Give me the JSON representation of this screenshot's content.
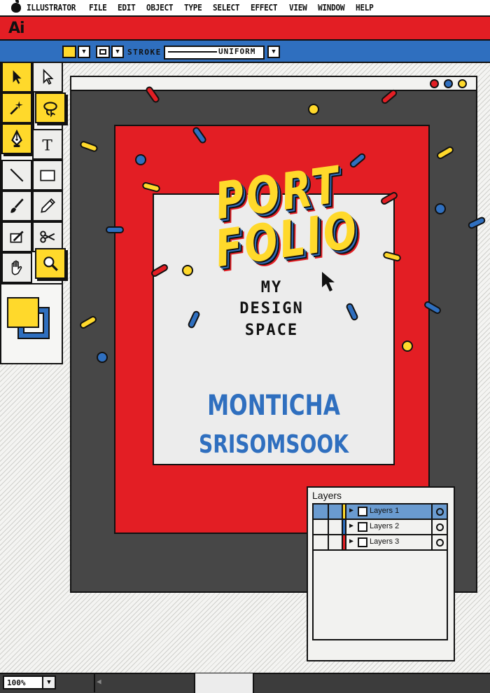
{
  "menu": {
    "apple_icon": "apple-icon",
    "items": [
      "ILLUSTRATOR",
      "FILE",
      "EDIT",
      "OBJECT",
      "TYPE",
      "SELECT",
      "EFFECT",
      "VIEW",
      "WINDOW",
      "HELP"
    ]
  },
  "app": {
    "logo": "Ai",
    "accent": "#e31e24",
    "toolbar_color": "#2f6fbf",
    "highlight": "#ffd92b"
  },
  "control_bar": {
    "stroke_label": "STROKE",
    "stroke_value": "UNIFORM",
    "fill_color": "#ffd92b",
    "stroke_color": "#ffffff"
  },
  "tools": [
    {
      "name": "selection-tool",
      "icon": "arrow-icon",
      "selected": true
    },
    {
      "name": "direct-selection-tool",
      "icon": "hollow-arrow-icon",
      "selected": false
    },
    {
      "name": "magic-wand-tool",
      "icon": "magic-wand-icon",
      "selected": true
    },
    {
      "name": "lasso-tool",
      "icon": "lasso-icon",
      "selected": true
    },
    {
      "name": "pen-tool",
      "icon": "pen-nib-icon",
      "selected": true
    },
    {
      "name": "type-tool",
      "icon": "text-T-icon",
      "selected": false
    },
    {
      "name": "line-tool",
      "icon": "line-icon",
      "selected": false
    },
    {
      "name": "rectangle-tool",
      "icon": "rectangle-icon",
      "selected": false
    },
    {
      "name": "paintbrush-tool",
      "icon": "paintbrush-icon",
      "selected": false
    },
    {
      "name": "pencil-tool",
      "icon": "pencil-icon",
      "selected": false
    },
    {
      "name": "eraser-tool",
      "icon": "eraser-icon",
      "selected": false
    },
    {
      "name": "scissors-tool",
      "icon": "scissors-icon",
      "selected": false
    },
    {
      "name": "hand-tool",
      "icon": "hand-icon",
      "selected": false
    },
    {
      "name": "zoom-tool",
      "icon": "magnifier-icon",
      "selected": true
    }
  ],
  "artwork": {
    "title_line1": "PORT",
    "title_line2": "FOLIO",
    "tagline": [
      "MY",
      "DESIGN",
      "SPACE"
    ],
    "author_first": "MONTICHA",
    "author_last": "SRISOMSOOK"
  },
  "window_buttons": [
    "#e31e24",
    "#2f6fbf",
    "#ffd92b"
  ],
  "layers_panel": {
    "title": "Layers",
    "layers": [
      {
        "name": "Layers 1",
        "color": "#ffd92b",
        "selected": true
      },
      {
        "name": "Layers 2",
        "color": "#2f6fbf",
        "selected": false
      },
      {
        "name": "Layers 3",
        "color": "#e31e24",
        "selected": false
      }
    ]
  },
  "status": {
    "zoom": "100%"
  }
}
